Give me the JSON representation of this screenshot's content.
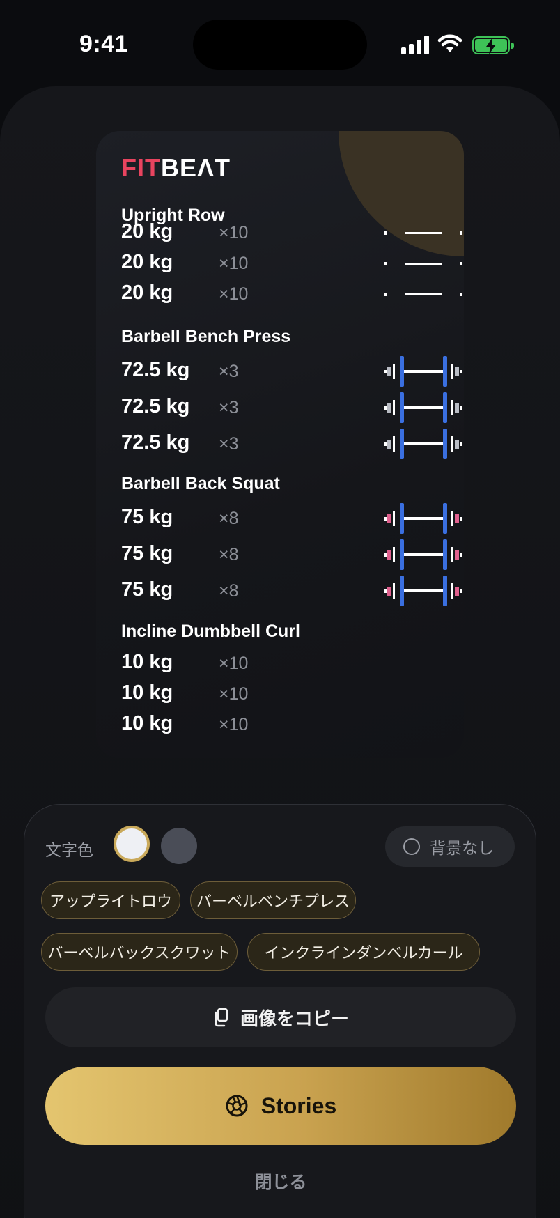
{
  "status_bar": {
    "time": "9:41"
  },
  "card": {
    "logo_part1": "FIT",
    "logo_part2": "BEΛT",
    "exercises": [
      {
        "name": "Upright Row",
        "sets": [
          {
            "weight": "20 kg",
            "reps": "×10"
          },
          {
            "weight": "20 kg",
            "reps": "×10"
          },
          {
            "weight": "20 kg",
            "reps": "×10"
          }
        ]
      },
      {
        "name": "Barbell Bench Press",
        "sets": [
          {
            "weight": "72.5 kg",
            "reps": "×3"
          },
          {
            "weight": "72.5 kg",
            "reps": "×3"
          },
          {
            "weight": "72.5 kg",
            "reps": "×3"
          }
        ]
      },
      {
        "name": "Barbell Back Squat",
        "sets": [
          {
            "weight": "75 kg",
            "reps": "×8"
          },
          {
            "weight": "75 kg",
            "reps": "×8"
          },
          {
            "weight": "75 kg",
            "reps": "×8"
          }
        ]
      },
      {
        "name": "Incline Dumbbell Curl",
        "sets": [
          {
            "weight": "10 kg",
            "reps": "×10"
          },
          {
            "weight": "10 kg",
            "reps": "×10"
          },
          {
            "weight": "10 kg",
            "reps": "×10"
          }
        ]
      }
    ]
  },
  "panel": {
    "text_color_label": "文字色",
    "no_background_label": "背景なし",
    "chips": [
      "アップライトロウ",
      "バーベルベンチプレス",
      "バーベルバックスクワット",
      "インクラインダンベルカール"
    ],
    "copy_label": "画像をコピー",
    "stories_label": "Stories",
    "close_label": "閉じる"
  },
  "colors": {
    "accent_gold": "#d9b560",
    "logo_red": "#e8445f",
    "plate_blue": "#3a6fe0",
    "plate_pink": "#e0608e",
    "plate_gray": "#b9bcc4"
  },
  "icons": [
    "signal-icon",
    "wifi-icon",
    "battery-icon",
    "copy-icon",
    "aperture-icon",
    "barbell-icon"
  ]
}
